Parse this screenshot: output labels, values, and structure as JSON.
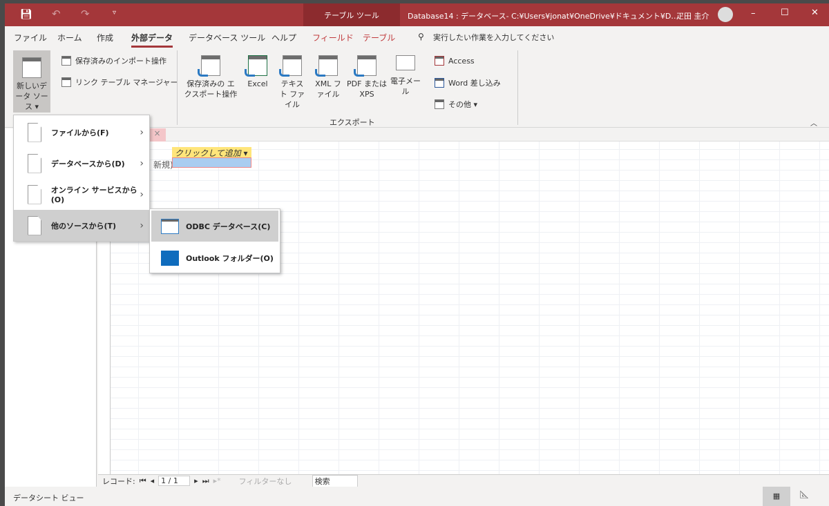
{
  "titlebar": {
    "context_tab": "テーブル ツール",
    "title": "Database14 : データベース- C:¥Users¥jonat¥OneDrive¥ドキュメント¥D…",
    "user": "疋田 圭介",
    "minimize": "–",
    "maximize": "☐",
    "close": "✕"
  },
  "tabs": [
    {
      "label": "ファイル"
    },
    {
      "label": "ホーム"
    },
    {
      "label": "作成"
    },
    {
      "label": "外部データ",
      "active": true
    },
    {
      "label": "データベース ツール"
    },
    {
      "label": "ヘルプ"
    },
    {
      "label": "フィールド",
      "contextual": true
    },
    {
      "label": "テーブル",
      "contextual": true
    }
  ],
  "tell_me": "実行したい作業を入力してください",
  "ribbon": {
    "new_source": "新しいデータ ソース ▾",
    "saved_imports": "保存済みのインポート操作",
    "linked_table_manager": "リンク テーブル マネージャー",
    "saved_exports": "保存済みの エクスポート操作",
    "excel": "Excel",
    "text_file": "テキスト ファイル",
    "xml_file": "XML ファイル",
    "pdf_xps": "PDF または XPS",
    "email": "電子メール",
    "access": "Access",
    "word_merge": "Word 差し込み",
    "more": "その他 ▾",
    "export_group": "エクスポート"
  },
  "menu": {
    "items": [
      {
        "label": "ファイルから(F)"
      },
      {
        "label": "データベースから(D)"
      },
      {
        "label": "オンライン サービスから(O)"
      },
      {
        "label": "他のソースから(T)",
        "selected": true
      }
    ]
  },
  "submenu": {
    "items": [
      {
        "label": "ODBC データベース(C)",
        "selected": true
      },
      {
        "label": "Outlook フォルダー(O)"
      }
    ]
  },
  "sheet": {
    "add_column": "クリックして追加",
    "new_row": "新規)",
    "close_tab": "×"
  },
  "record_nav": {
    "label": "レコード:",
    "position": "1 / 1",
    "filter": "フィルターなし",
    "search": "検索"
  },
  "status": {
    "view": "データシート ビュー"
  },
  "colors": {
    "accent": "#a4373a"
  }
}
